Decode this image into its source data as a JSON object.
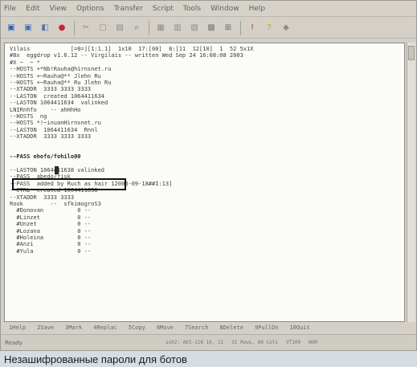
{
  "menu": [
    "File",
    "Edit",
    "View",
    "Options",
    "Transfer",
    "Script",
    "Tools",
    "Window",
    "Help"
  ],
  "toolbar": {
    "icons": [
      {
        "name": "open-icon",
        "glyph": "▣",
        "color": "#2f5fa8"
      },
      {
        "name": "save-icon",
        "glyph": "▣",
        "color": "#3b6fb8"
      },
      {
        "name": "connect-icon",
        "glyph": "◧",
        "color": "#5577aa"
      },
      {
        "name": "disconnect-icon",
        "glyph": "●",
        "color": "#c8272b"
      },
      {
        "name": "cut-icon",
        "glyph": "✂",
        "color": "#8a8a8a"
      },
      {
        "name": "copy-icon",
        "glyph": "▢",
        "color": "#8d8d8d"
      },
      {
        "name": "paste-icon",
        "glyph": "▤",
        "color": "#8d8d8d"
      },
      {
        "name": "find-icon",
        "glyph": "⌕",
        "color": "#4d6f9a"
      },
      {
        "name": "properties-icon",
        "glyph": "▦",
        "color": "#8d8d8d"
      },
      {
        "name": "log-icon",
        "glyph": "▥",
        "color": "#8d8d8d"
      },
      {
        "name": "print-icon",
        "glyph": "▧",
        "color": "#8d8d8d"
      },
      {
        "name": "settings-icon",
        "glyph": "▩",
        "color": "#7b7b7b"
      },
      {
        "name": "keymap-icon",
        "glyph": "⊞",
        "color": "#6b6b6b"
      },
      {
        "name": "alert-icon",
        "glyph": "!",
        "color": "#c8272b"
      },
      {
        "name": "help-icon",
        "glyph": "?",
        "color": "#c9a21b"
      },
      {
        "name": "about-icon",
        "glyph": "◆",
        "color": "#8d8d8d"
      }
    ]
  },
  "terminal": {
    "lines": [
      {
        "text": "Vilais            [=0=][1:1.1]  1x10  17:[00]  8:[11  12[10]  1  52 5x1X",
        "strong": false
      },
      {
        "text": "#8x  eggdrop v1.6.12 -- Virgilais -- written Wed Sep 24 16:08:08 2003",
        "strong": false
      },
      {
        "text": "#X ~  ~ *",
        "strong": false
      },
      {
        "text": "--HOSTS +*Nb!Rauha@hirnsnet.ru",
        "strong": false
      },
      {
        "text": "--HOSTS +~Rauha@** Jlehn Ru",
        "strong": false
      },
      {
        "text": "--HOSTS +~Rauha@** Ru Jlehn Ru",
        "strong": false
      },
      {
        "text": "--XTADDR  3333 3333 3333",
        "strong": false
      },
      {
        "text": "--LASTON  created 1064411634",
        "strong": false
      },
      {
        "text": "--LASTON 1064411634  valinked",
        "strong": false
      },
      {
        "text": "LNIRnhTo    -- ahHhHo",
        "strong": false
      },
      {
        "text": "--HOSTS  ng",
        "strong": false
      },
      {
        "text": "--HOSTS *!~inuanHirnsnet.ru",
        "strong": false
      },
      {
        "text": "--LASTON  1064411634  Rnnl",
        "strong": false
      },
      {
        "text": "--XTADDR  3333 3333 3333",
        "strong": false
      },
      {
        "text": "",
        "strong": false
      },
      {
        "text": "",
        "strong": false
      },
      {
        "text": "--PASS ehofo/fohilo00",
        "strong": true
      },
      {
        "text": "",
        "strong": false
      },
      {
        "text": "--LASTON 1064411638 valinked",
        "strong": false
      },
      {
        "text": "--PASS  abedo/fisk",
        "strong": false
      },
      {
        "text": "--PASS  added by Ruch as hair 12003-09-18##I:13]",
        "strong": false
      },
      {
        "text": "--CTRL  created 1064411638",
        "strong": false
      },
      {
        "text": "--XTADDR  3333 3333",
        "strong": false
      },
      {
        "text": "Rook        --  sfkimogroS3",
        "strong": false
      },
      {
        "text": "  #Donovan          0 --",
        "strong": false
      },
      {
        "text": "  #Linzet           0 --",
        "strong": false
      },
      {
        "text": "  #Unzet            0 --",
        "strong": false
      },
      {
        "text": "  #Lozana           0 --",
        "strong": false
      },
      {
        "text": "  #Holeina          0 --",
        "strong": false
      },
      {
        "text": "  #Anzi             0 --",
        "strong": false
      },
      {
        "text": "  #Yula             0 --",
        "strong": false
      }
    ]
  },
  "function_keys": [
    "1Help",
    "2Save",
    "3Mark",
    "4Replac",
    "5Copy",
    "6Move",
    "7Search",
    "8Delete",
    "9PullDn",
    "10Quit"
  ],
  "statusbar": {
    "left": "Ready",
    "segments": [
      "ssh2: AES-128   10, 11",
      "31 Rows, 80 Cols",
      "VT100",
      "NUM"
    ]
  },
  "caption": "Незашифрованные пароли для ботов"
}
